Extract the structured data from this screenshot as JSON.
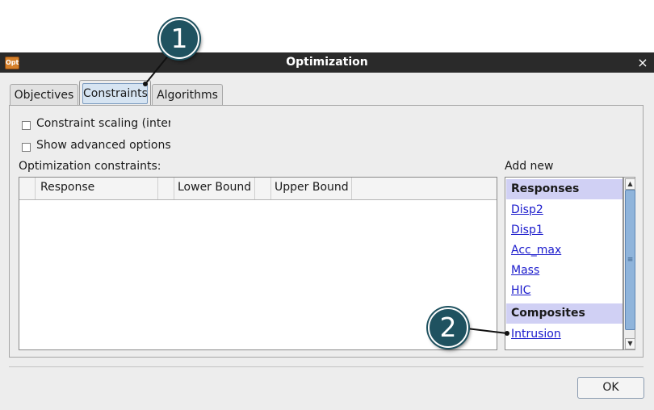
{
  "window": {
    "title": "Optimization",
    "icon": "opt-app-icon",
    "close": "×"
  },
  "tabs": [
    {
      "label": "Objectives",
      "active": false
    },
    {
      "label": "Constraints",
      "active": true
    },
    {
      "label": "Algorithms",
      "active": false
    }
  ],
  "options": {
    "constraint_scaling": {
      "label": "Constraint scaling (interna",
      "checked": false
    },
    "show_advanced": {
      "label": "Show advanced options",
      "checked": false
    }
  },
  "constraints_table": {
    "label": "Optimization constraints:",
    "columns": [
      "Response",
      "Lower Bound",
      "Upper Bound"
    ],
    "rows": []
  },
  "add_new": {
    "label": "Add new",
    "sections": [
      {
        "title": "Responses",
        "items": [
          "Disp2",
          "Disp1",
          "Acc_max",
          "Mass",
          "HIC"
        ]
      },
      {
        "title": "Composites",
        "items": [
          "Intrusion"
        ]
      }
    ]
  },
  "buttons": {
    "ok": "OK"
  },
  "callouts": [
    "1",
    "2"
  ],
  "colors": {
    "titlebar": "#2a2a2a",
    "section_bg": "#d0d0f4",
    "link": "#1a1acc",
    "callout": "#1f5260"
  }
}
